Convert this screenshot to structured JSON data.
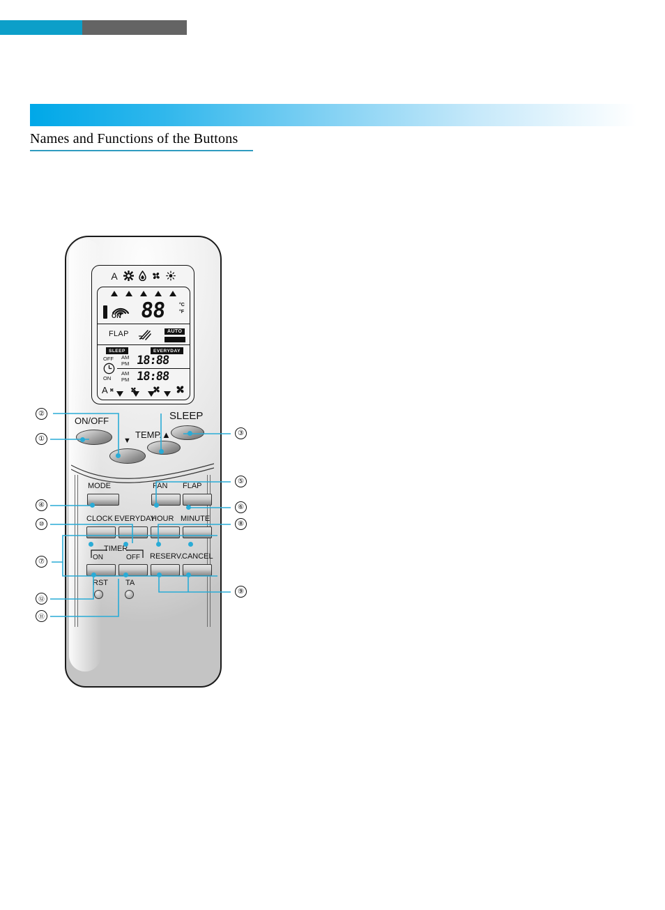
{
  "page": {
    "title": "Names and Functions of the Buttons",
    "accent_color": "#00A8E8",
    "bar_cyan": "#0C9FC9",
    "bar_gray": "#646464",
    "rule_color": "#2E9BC0",
    "leader_color": "#29ABD6"
  },
  "remote": {
    "lcd": {
      "mode_icons": [
        "auto-a-icon",
        "cool-snowflake-icon",
        "dry-drop-icon",
        "fan-blade-icon",
        "heat-sun-icon"
      ],
      "indicator_triangles_up": 5,
      "indicator_triangles_down": 4,
      "battery_icon": "battery-bar-icon",
      "signal_icon": "signal-waves-icon",
      "on_label": "ON",
      "temperature_digits": "88",
      "unit_c": "°C",
      "unit_f": "°F",
      "flap_label": "FLAP",
      "flap_icon": "flap-wave-icon",
      "auto_badge": "AUTO",
      "sleep_badge": "SLEEP",
      "everyday_badge": "EVERYDAY",
      "timer_off_label": "OFF",
      "timer_on_label": "ON",
      "clock_icon": "clock-icon",
      "am_label": "AM",
      "pm_label": "PM",
      "timer_off_time": "18:88",
      "timer_on_time": "18:88",
      "fan_speed_icons": [
        "fan-auto-icon",
        "fan-low-icon",
        "fan-medium-icon",
        "fan-high-icon"
      ]
    },
    "oval_buttons": [
      {
        "id": "on-off",
        "label": "ON/OFF"
      },
      {
        "id": "sleep",
        "label": "SLEEP"
      },
      {
        "id": "temp",
        "label": "TEMP.▲"
      },
      {
        "id": "temp-down",
        "label": "▼"
      }
    ],
    "panel_buttons": [
      {
        "id": "mode",
        "label": "MODE"
      },
      {
        "id": "fan",
        "label": "FAN"
      },
      {
        "id": "flap",
        "label": "FLAP"
      },
      {
        "id": "clock",
        "label": "CLOCK"
      },
      {
        "id": "everyday",
        "label": "EVERYDAY"
      },
      {
        "id": "hour",
        "label": "HOUR"
      },
      {
        "id": "minute",
        "label": "MINUTE"
      },
      {
        "id": "timer-on",
        "label": "ON"
      },
      {
        "id": "timer-off",
        "label": "OFF"
      },
      {
        "id": "reserv",
        "label": "RESERV."
      },
      {
        "id": "cancel",
        "label": "CANCEL"
      },
      {
        "id": "rst",
        "label": "RST"
      },
      {
        "id": "ta",
        "label": "TA"
      }
    ],
    "timer_group_label": "TIMER"
  },
  "callouts": {
    "c1": "①",
    "c2": "②",
    "c3": "③",
    "c4": "④",
    "c5": "⑤",
    "c6": "⑥",
    "c7": "⑦",
    "c8": "⑧",
    "c9": "⑨",
    "c10": "⑩",
    "c11": "⑪",
    "c12": "⑫"
  }
}
